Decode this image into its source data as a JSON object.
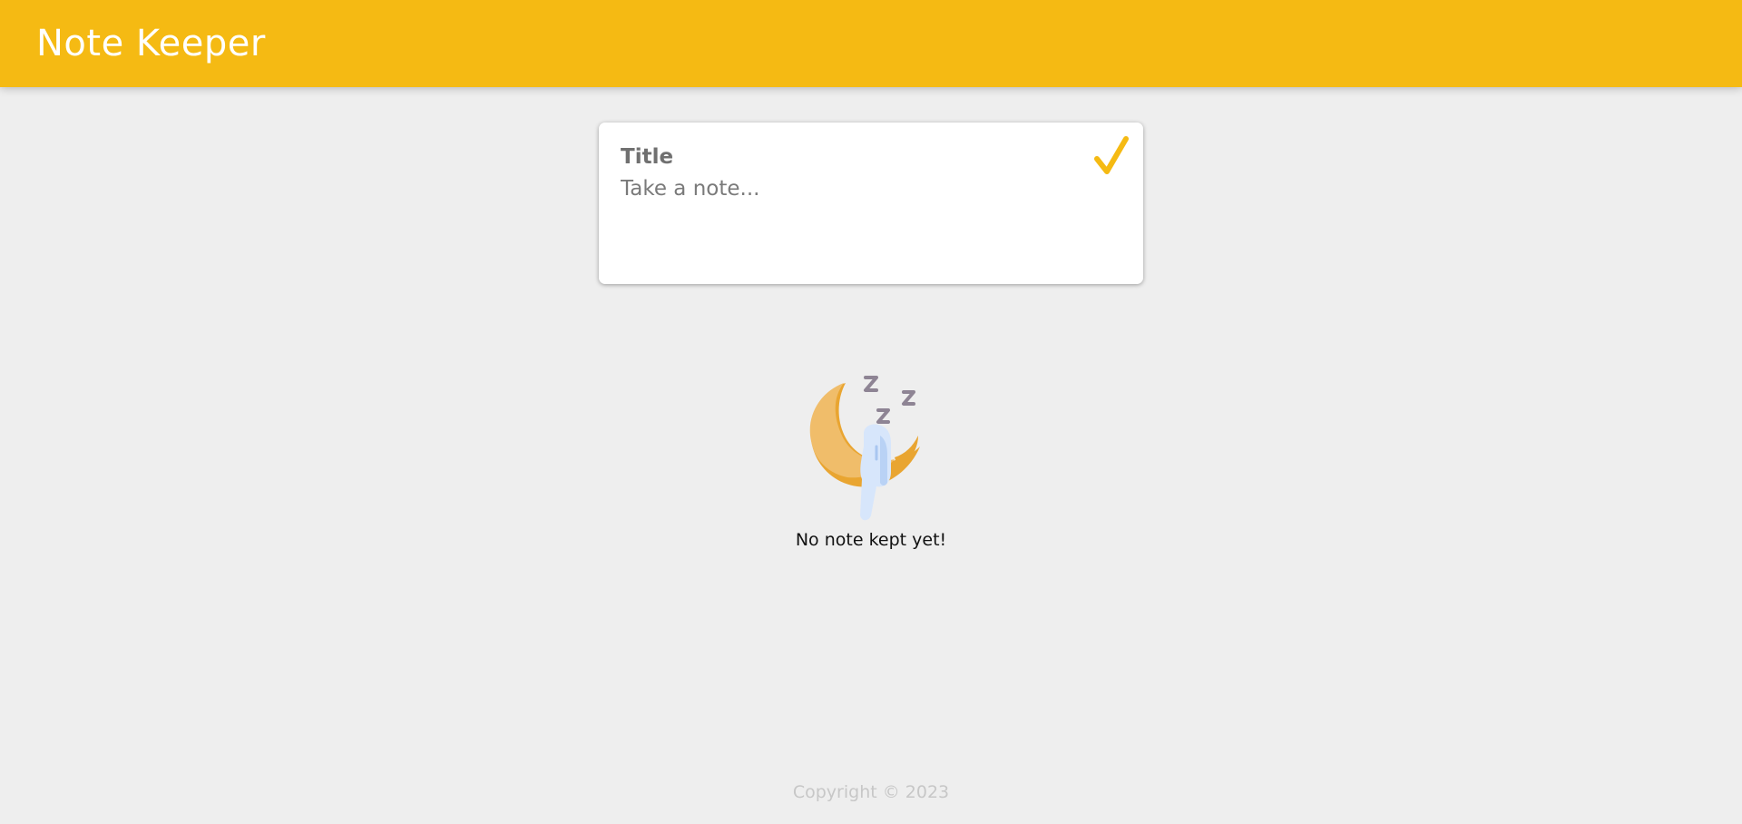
{
  "header": {
    "app_title": "Note Keeper"
  },
  "note_form": {
    "title_placeholder": "Title",
    "content_placeholder": "Take a note...",
    "submit_icon": "checkmark-icon"
  },
  "empty_state": {
    "illustration": "sleeping-moon-icon",
    "message": "No note kept yet!"
  },
  "footer": {
    "copyright": "Copyright © 2023"
  },
  "colors": {
    "accent": "#f5ba13",
    "background": "#eeeeee",
    "card": "#ffffff"
  }
}
